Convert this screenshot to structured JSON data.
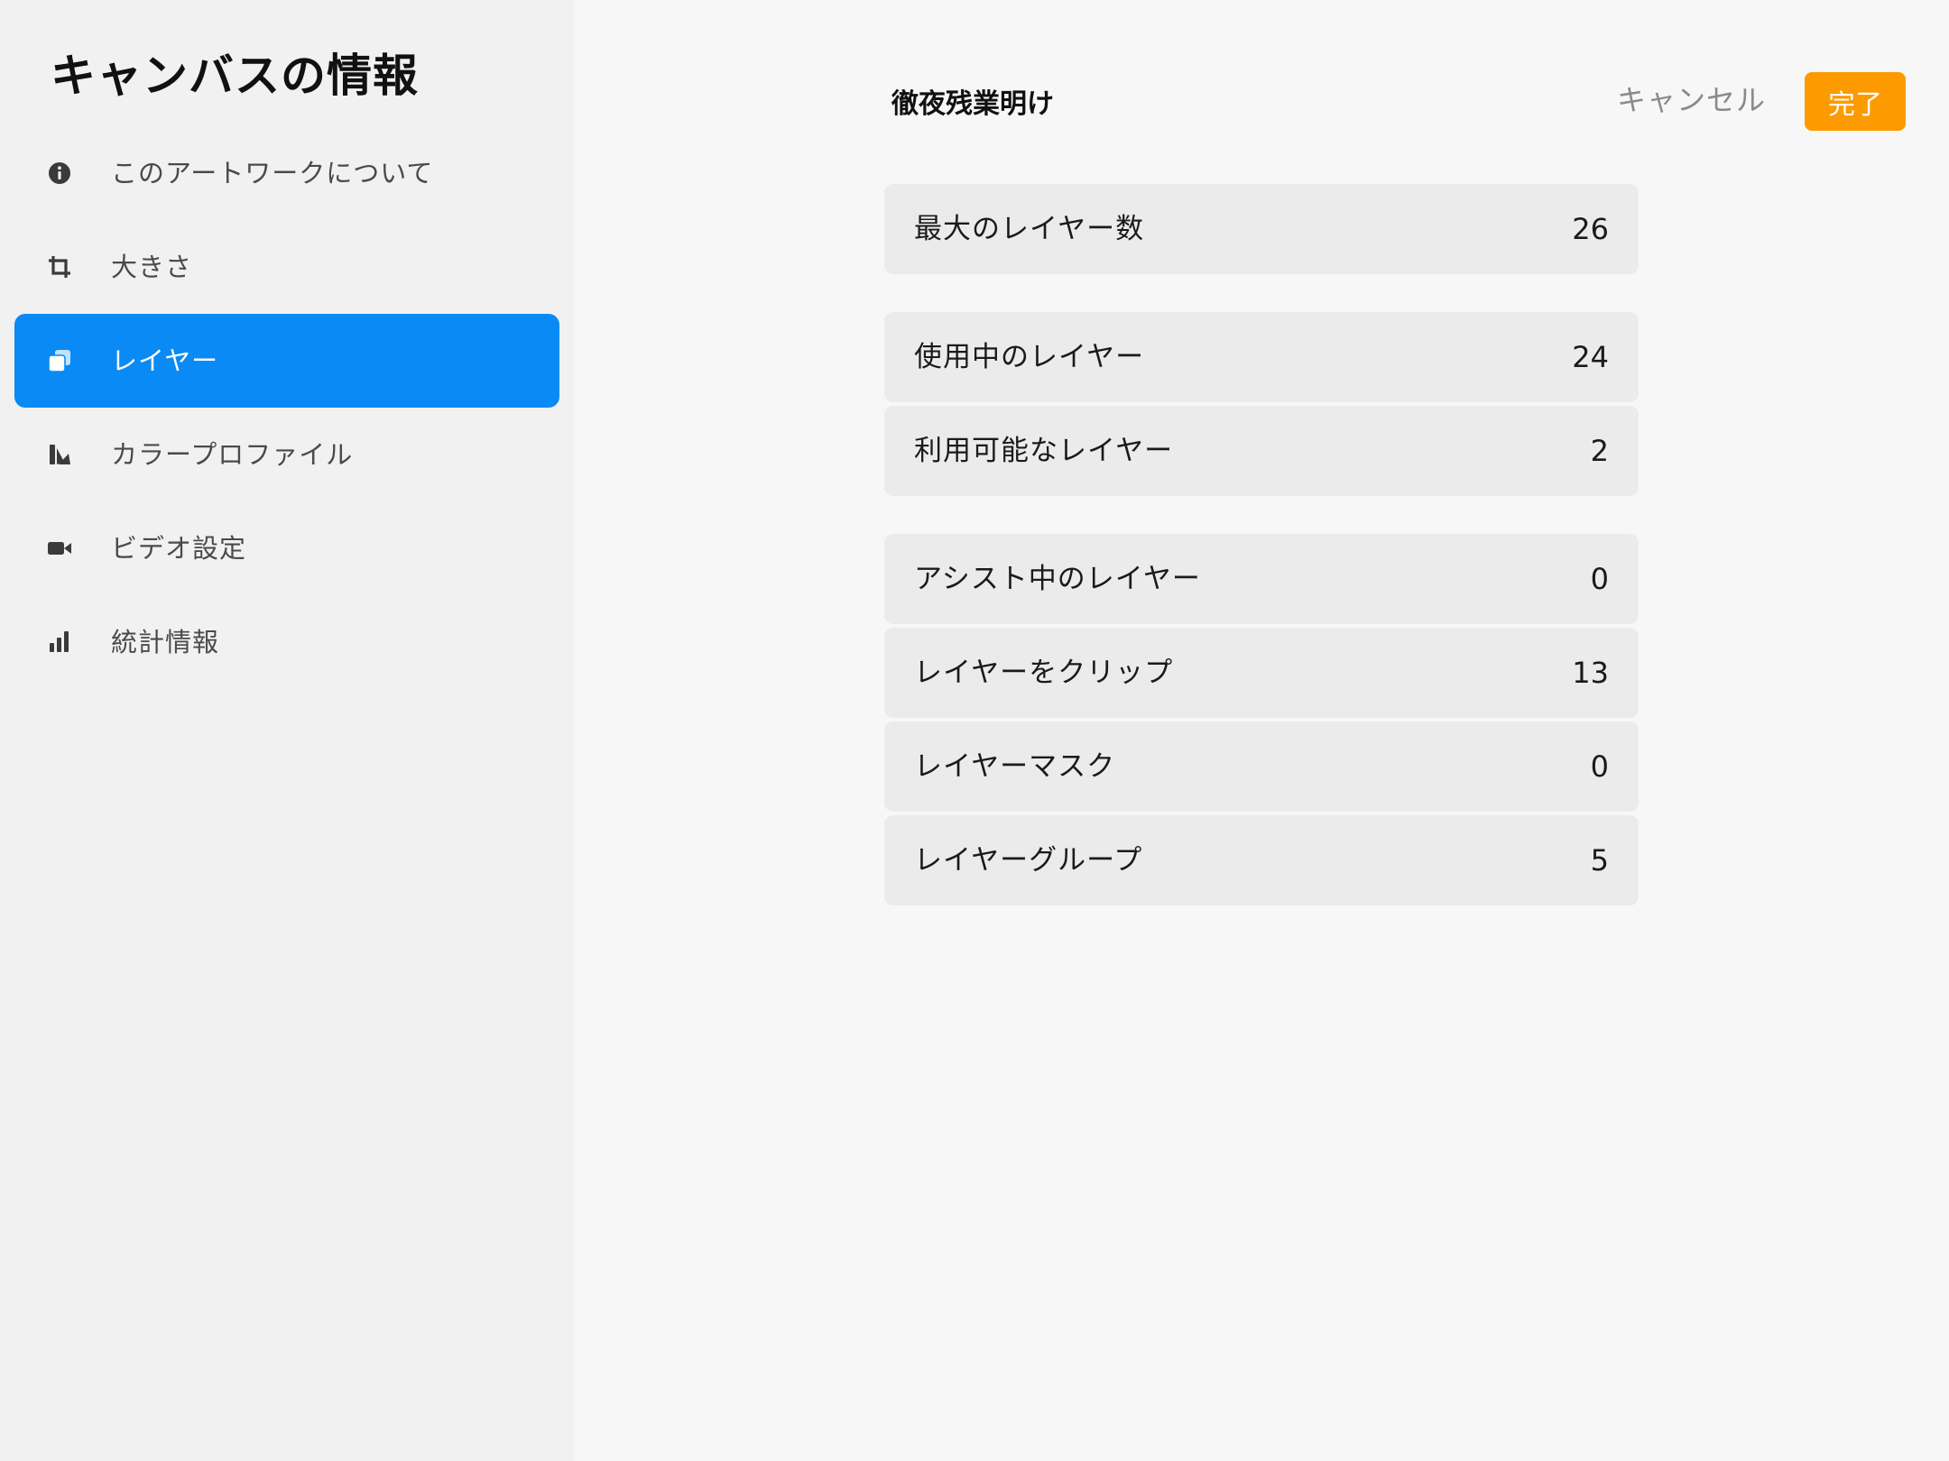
{
  "sidebar": {
    "title": "キャンバスの情報",
    "items": [
      {
        "label": "このアートワークについて",
        "icon": "info-icon",
        "active": false
      },
      {
        "label": "大きさ",
        "icon": "crop-icon",
        "active": false
      },
      {
        "label": "レイヤー",
        "icon": "layers-icon",
        "active": true
      },
      {
        "label": "カラープロファイル",
        "icon": "color-profile-icon",
        "active": false
      },
      {
        "label": "ビデオ設定",
        "icon": "video-camera-icon",
        "active": false
      },
      {
        "label": "統計情報",
        "icon": "bar-chart-icon",
        "active": false
      }
    ]
  },
  "header": {
    "doc_title": "徹夜残業明け",
    "cancel_label": "キャンセル",
    "done_label": "完了"
  },
  "stats": [
    {
      "label": "最大のレイヤー数",
      "value": "26"
    },
    {
      "label": "使用中のレイヤー",
      "value": "24"
    },
    {
      "label": "利用可能なレイヤー",
      "value": "2"
    },
    {
      "label": "アシスト中のレイヤー",
      "value": "0"
    },
    {
      "label": "レイヤーをクリップ",
      "value": "13"
    },
    {
      "label": "レイヤーマスク",
      "value": "0"
    },
    {
      "label": "レイヤーグループ",
      "value": "5"
    }
  ],
  "colors": {
    "accent_blue": "#0a8af5",
    "done_orange": "#fd9a00",
    "sidebar_bg": "#f1f1f1",
    "row_bg": "#ebebeb"
  }
}
